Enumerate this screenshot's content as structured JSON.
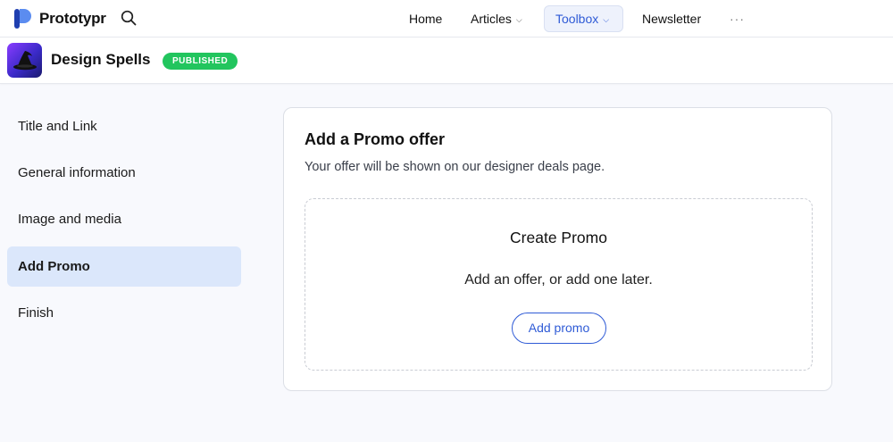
{
  "brand": {
    "name": "Prototypr",
    "color": "#3a6ee8"
  },
  "topnav": {
    "items": [
      {
        "label": "Home"
      },
      {
        "label": "Articles",
        "has_dropdown": true
      },
      {
        "label": "Toolbox",
        "has_dropdown": true,
        "active": true
      },
      {
        "label": "Newsletter"
      },
      {
        "label": "···"
      }
    ],
    "chevron": "⌵"
  },
  "product": {
    "title": "Design Spells",
    "status": "PUBLISHED",
    "status_color": "#22c55e",
    "icon": "wizard-hat-icon"
  },
  "sidebar": {
    "items": [
      {
        "label": "Title and Link"
      },
      {
        "label": "General information"
      },
      {
        "label": "Image and media"
      },
      {
        "label": "Add Promo",
        "active": true
      },
      {
        "label": "Finish"
      }
    ]
  },
  "promo": {
    "title": "Add a Promo offer",
    "subtitle": "Your offer will be shown on our designer deals page.",
    "empty_title": "Create Promo",
    "empty_text": "Add an offer, or add one later.",
    "button_label": "Add promo"
  },
  "colors": {
    "accent": "#2f5bd6",
    "active_bg": "#dbe7fb"
  }
}
